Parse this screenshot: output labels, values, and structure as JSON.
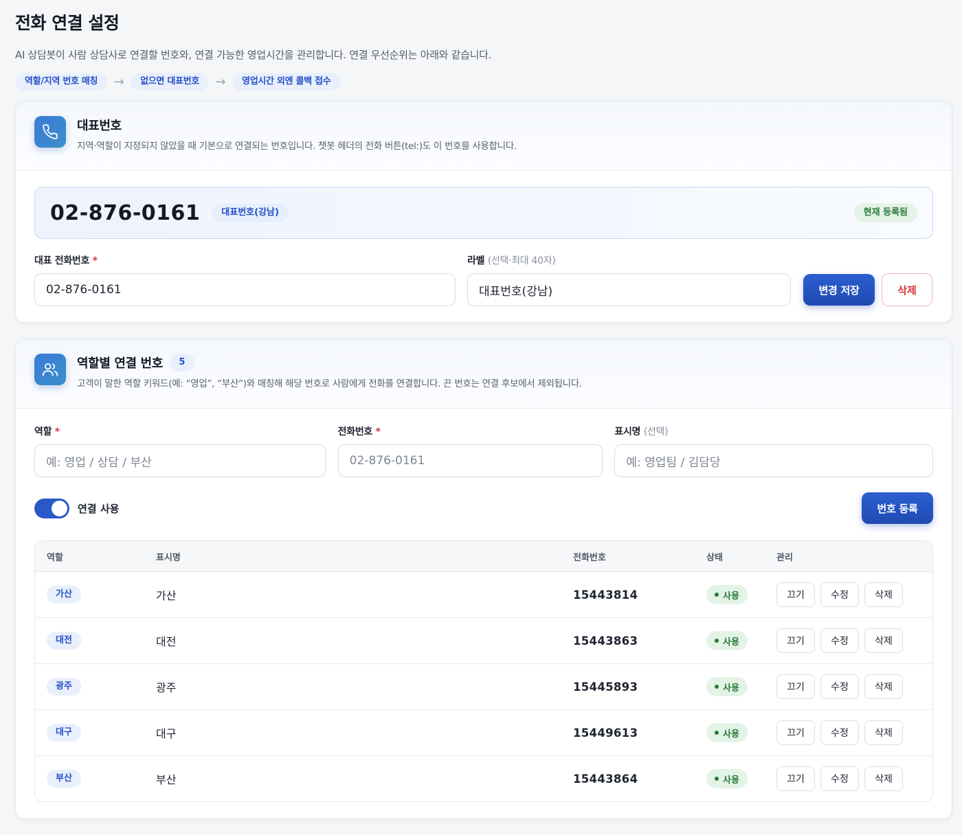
{
  "page": {
    "title": "전화 연결 설정",
    "description": "AI 상담봇이 사람 상담사로 연결할 번호와, 연결 가능한 영업시간을 관리합니다. 연결 우선순위는 아래와 같습니다.",
    "priority_steps": [
      "역할/지역 번호 매칭",
      "없으면 대표번호",
      "영업시간 외엔 콜백 접수"
    ],
    "arrow": "→"
  },
  "main_number": {
    "title": "대표번호",
    "description": "지역·역할이 지정되지 않았을 때 기본으로 연결되는 번호입니다. 챗봇 헤더의 전화 버튼(tel:)도 이 번호를 사용합니다.",
    "icon": "phone-icon",
    "current_number": "02-876-0161",
    "current_label": "대표번호(강남)",
    "registered_badge": "현재 등록됨",
    "phone_field_label": "대표 전화번호",
    "phone_field_required": "*",
    "phone_value": "02-876-0161",
    "label_field_label": "라벨",
    "label_field_hint": "(선택·최대 40자)",
    "label_value": "대표번호(강남)",
    "save_button": "변경 저장",
    "delete_button": "삭제"
  },
  "role_numbers": {
    "title": "역할별 연결 번호",
    "count": "5",
    "description": "고객이 말한 역할 키워드(예: “영업”, “부산”)와 매칭해 해당 번호로 사람에게 전화를 연결합니다. 끈 번호는 연결 후보에서 제외됩니다.",
    "icon": "users-icon",
    "role_label": "역할",
    "role_required": "*",
    "role_placeholder": "예: 영업 / 상담 / 부산",
    "phone_label": "전화번호",
    "phone_required": "*",
    "phone_placeholder": "02-876-0161",
    "display_label": "표시명",
    "display_hint": "(선택)",
    "display_placeholder": "예: 영업팀 / 김담당",
    "toggle_label": "연결 사용",
    "toggle_on": true,
    "register_button": "번호 등록",
    "columns": [
      "역할",
      "표시명",
      "전화번호",
      "상태",
      "관리"
    ],
    "rows": [
      {
        "role": "가산",
        "name": "가산",
        "phone": "15443814",
        "status": "사용",
        "off": "끄기",
        "edit": "수정",
        "delete": "삭제"
      },
      {
        "role": "대전",
        "name": "대전",
        "phone": "15443863",
        "status": "사용",
        "off": "끄기",
        "edit": "수정",
        "delete": "삭제"
      },
      {
        "role": "광주",
        "name": "광주",
        "phone": "15445893",
        "status": "사용",
        "off": "끄기",
        "edit": "수정",
        "delete": "삭제"
      },
      {
        "role": "대구",
        "name": "대구",
        "phone": "15449613",
        "status": "사용",
        "off": "끄기",
        "edit": "수정",
        "delete": "삭제"
      },
      {
        "role": "부산",
        "name": "부산",
        "phone": "15443864",
        "status": "사용",
        "off": "끄기",
        "edit": "수정",
        "delete": "삭제"
      }
    ]
  },
  "colors": {
    "accent": "#2350c8",
    "primary_button": "#1f4ab4",
    "danger": "#d9363e",
    "success": "#2b7a3b",
    "chip_bg": "#e9effb"
  }
}
